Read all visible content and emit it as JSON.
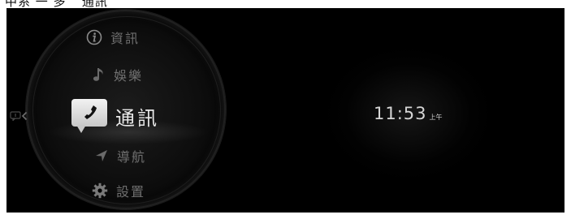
{
  "top_label": "中系 一 多 ^通訊",
  "menu": {
    "items": [
      {
        "id": "info",
        "label": "資訊",
        "icon": "info-icon"
      },
      {
        "id": "entertainment",
        "label": "娛樂",
        "icon": "music-note-icon"
      },
      {
        "id": "communication",
        "label": "通訊",
        "icon": "phone-icon",
        "selected": true
      },
      {
        "id": "navigation",
        "label": "導航",
        "icon": "navigation-arrow-icon"
      },
      {
        "id": "settings",
        "label": "設置",
        "icon": "gear-icon"
      }
    ]
  },
  "side_panel": {
    "icon": "message-icon",
    "arrow": "chevron-left-icon"
  },
  "clock": {
    "time": "11:53",
    "ampm": "上午"
  },
  "colors": {
    "background": "#000000",
    "selected_text": "#e8e8e8",
    "menu_text": "#6f6f6f",
    "clock_text": "#d6d6d6"
  }
}
